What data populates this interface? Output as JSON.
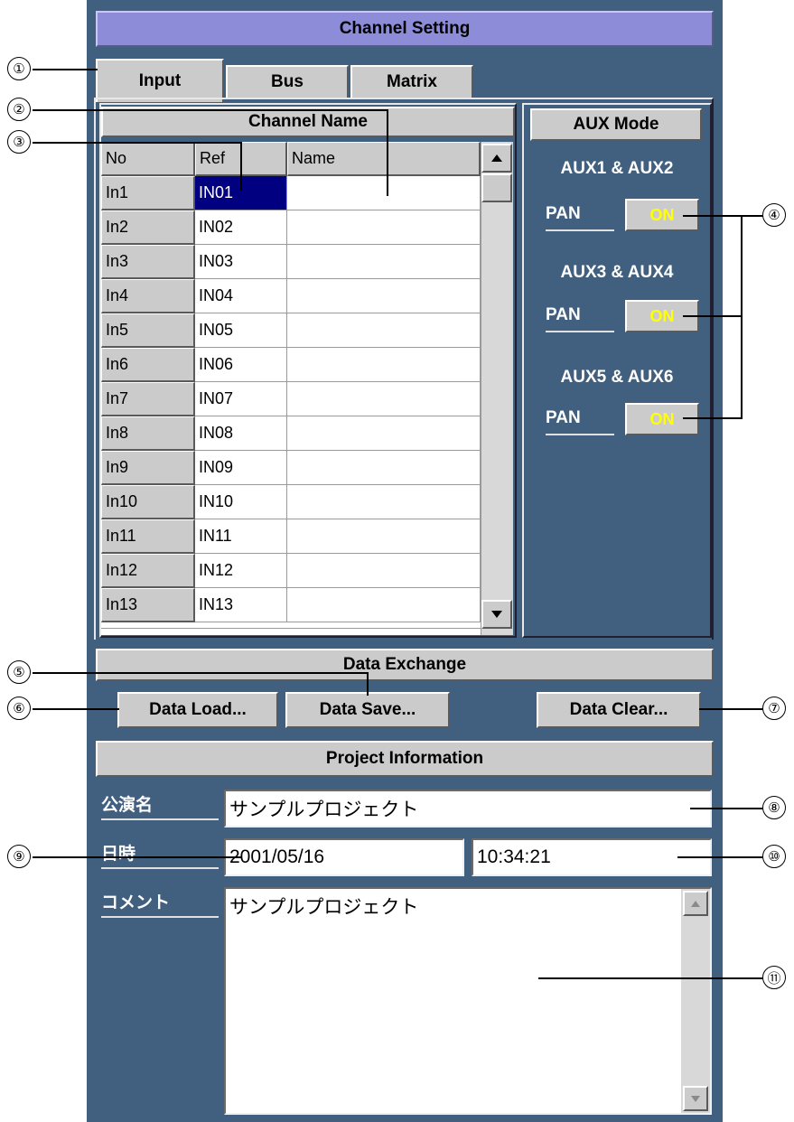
{
  "header": {
    "title": "Channel Setting"
  },
  "tabs": [
    {
      "label": "Input",
      "active": true
    },
    {
      "label": "Bus",
      "active": false
    },
    {
      "label": "Matrix",
      "active": false
    }
  ],
  "channel_name": {
    "title": "Channel Name",
    "columns": [
      "No",
      "Ref",
      "Name"
    ],
    "rows": [
      {
        "no": "In1",
        "ref": "IN01",
        "name": ""
      },
      {
        "no": "In2",
        "ref": "IN02",
        "name": ""
      },
      {
        "no": "In3",
        "ref": "IN03",
        "name": ""
      },
      {
        "no": "In4",
        "ref": "IN04",
        "name": ""
      },
      {
        "no": "In5",
        "ref": "IN05",
        "name": ""
      },
      {
        "no": "In6",
        "ref": "IN06",
        "name": ""
      },
      {
        "no": "In7",
        "ref": "IN07",
        "name": ""
      },
      {
        "no": "In8",
        "ref": "IN08",
        "name": ""
      },
      {
        "no": "In9",
        "ref": "IN09",
        "name": ""
      },
      {
        "no": "In10",
        "ref": "IN10",
        "name": ""
      },
      {
        "no": "In11",
        "ref": "IN11",
        "name": ""
      },
      {
        "no": "In12",
        "ref": "IN12",
        "name": ""
      },
      {
        "no": "In13",
        "ref": "IN13",
        "name": ""
      }
    ],
    "selected_row": 0
  },
  "aux_mode": {
    "title": "AUX Mode",
    "groups": [
      {
        "label": "AUX1 & AUX2",
        "mode": "PAN",
        "state": "ON"
      },
      {
        "label": "AUX3 & AUX4",
        "mode": "PAN",
        "state": "ON"
      },
      {
        "label": "AUX5 & AUX6",
        "mode": "PAN",
        "state": "ON"
      }
    ]
  },
  "data_exchange": {
    "title": "Data Exchange",
    "load_label": "Data Load...",
    "save_label": "Data Save...",
    "clear_label": "Data Clear..."
  },
  "project_info": {
    "title": "Project Information",
    "name_label": "公演名",
    "name_value": "サンプルプロジェクト",
    "datetime_label": "日時",
    "date_value": "2001/05/16",
    "time_value": "10:34:21",
    "comment_label": "コメント",
    "comment_value": "サンプルプロジェクト"
  },
  "callouts": [
    "①",
    "②",
    "③",
    "④",
    "⑤",
    "⑥",
    "⑦",
    "⑧",
    "⑨",
    "⑩",
    "⑪"
  ],
  "colors": {
    "panel": "#41607f",
    "title_bar": "#8c8cd8",
    "selection": "#000080",
    "on_text": "#ffff00"
  }
}
